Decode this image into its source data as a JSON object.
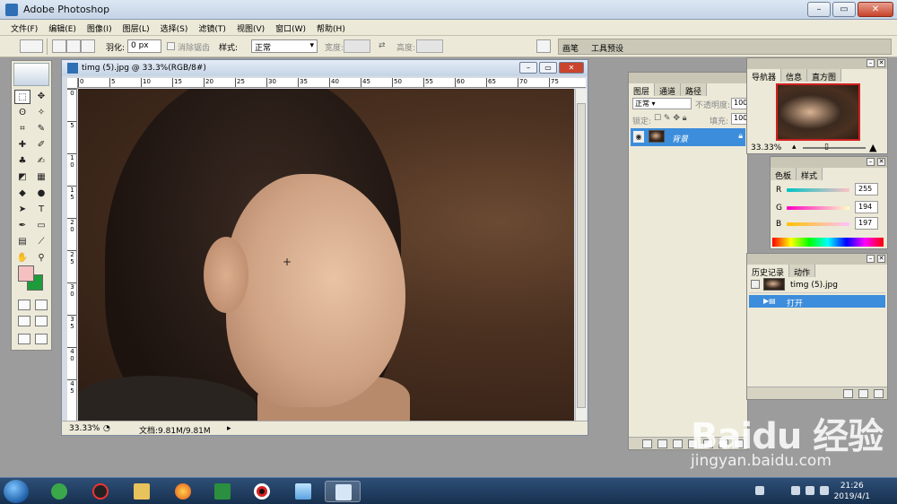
{
  "app": {
    "title": "Adobe Photoshop"
  },
  "menu": [
    "文件(F)",
    "编辑(E)",
    "图像(I)",
    "图层(L)",
    "选择(S)",
    "滤镜(T)",
    "视图(V)",
    "窗口(W)",
    "帮助(H)"
  ],
  "options": {
    "feather_label": "羽化:",
    "feather_value": "0 px",
    "antialias_label": "消除锯齿",
    "style_label": "样式:",
    "style_value": "正常",
    "width_label": "宽度:",
    "height_label": "高度:"
  },
  "palette_well": {
    "tab1": "画笔",
    "tab2": "工具预设"
  },
  "document": {
    "title": "timg (5).jpg @ 33.3%(RGB/8#)",
    "zoom": "33.33%",
    "doc_size": "文档:9.81M/9.81M",
    "ruler_top": [
      "0",
      "5",
      "10",
      "15",
      "20",
      "25",
      "30",
      "35",
      "40",
      "45",
      "50",
      "55",
      "60",
      "65",
      "70",
      "75"
    ],
    "ruler_left": [
      "0",
      "5",
      "1\n0",
      "1\n5",
      "2\n0",
      "2\n5",
      "3\n0",
      "3\n5",
      "4\n0",
      "4\n5"
    ]
  },
  "layers_panel": {
    "tabs": [
      "图层",
      "通道",
      "路径"
    ],
    "blend_mode": "正常",
    "opacity_label": "不透明度:",
    "opacity_value": "100",
    "lock_label": "锁定:",
    "fill_label": "填充:",
    "fill_value": "100",
    "layer_name": "背景"
  },
  "navigator_panel": {
    "tabs": [
      "导航器",
      "信息",
      "直方图"
    ],
    "zoom": "33.33%"
  },
  "color_panel": {
    "tabs": [
      "色板",
      "样式"
    ],
    "r_label": "R",
    "r_value": "255",
    "g_label": "G",
    "g_value": "194",
    "b_label": "B",
    "b_value": "197"
  },
  "history_panel": {
    "tabs": [
      "历史记录",
      "动作"
    ],
    "snapshot": "timg (5).jpg",
    "step": "打开"
  },
  "taskbar": {
    "time": "21:26",
    "date": "2019/4/1"
  },
  "watermark": {
    "logo": "Baidu 经验",
    "url": "jingyan.baidu.com"
  },
  "colors": {
    "foreground": "#f5c0c0",
    "background": "#1f9c3a",
    "selection": "#3c8ddb"
  }
}
